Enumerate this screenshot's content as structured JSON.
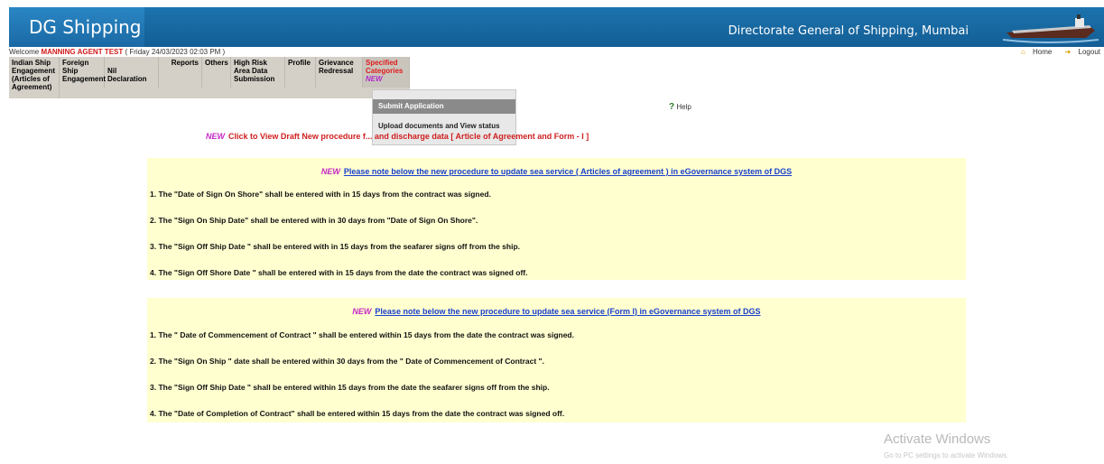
{
  "header": {
    "app_title": "DG Shipping",
    "org_title": "Directorate General of Shipping, Mumbai"
  },
  "welcome": {
    "prefix": "Welcome",
    "agent": "MANNING AGENT TEST",
    "datetime": "( Friday 24/03/2023 02:03 PM )",
    "home_label": "Home",
    "logout_label": "Logout"
  },
  "menu": {
    "items": [
      "Indian Ship Engagement (Articles of Agreement)",
      "Foreign Ship Engagement",
      "Nil Declaration",
      "Reports",
      "Others",
      "High Risk Area Data Submission",
      "Profile",
      "Grievance Redressal",
      "Specified Categories"
    ],
    "new_badge": "NEW"
  },
  "dropdown": {
    "items": [
      "Submit Application",
      "Upload documents and View status"
    ]
  },
  "help_label": "Help",
  "draft_notice": "Click to View Draft New procedure f... and discharge data [ Article of Agreement and Form - I ]",
  "panel1": {
    "heading": "Please note below the new procedure to update sea service ( Articles of agreement ) in eGovernance system of DGS",
    "rules": [
      "1. The \"Date of Sign On Shore\" shall be entered with in 15 days from the contract was signed.",
      "2. The \"Sign On Ship Date\" shall be entered with in 30 days from \"Date of Sign On Shore\".",
      "3. The \"Sign Off Ship Date \" shall be entered with in 15 days from the seafarer signs off from the ship.",
      "4. The \"Sign Off Shore Date \" shall be entered with in 15 days from the date the contract was signed off."
    ]
  },
  "panel2": {
    "heading": "Please note below the new procedure to update sea service (Form I) in eGovernance system of DGS",
    "rules": [
      "1. The \" Date of Commencement of Contract \" shall be entered within 15 days from the date the contract was signed.",
      "2. The \"Sign On Ship \" date shall be entered within 30 days from the \" Date of Commencement of Contract \".",
      "3. The \"Sign Off Ship Date \" shall be entered within 15 days from the date the seafarer signs off from the ship.",
      "4. The \"Date of Completion of Contract\" shall be entered within 15 days from the date the contract was signed off."
    ]
  },
  "watermark": {
    "title": "Activate Windows",
    "subtitle": "Go to PC settings to activate Windows."
  },
  "colors": {
    "header_blue": "#1c73ae",
    "agent_red": "#d11a1a",
    "new_magenta": "#c428c4",
    "panel_yellow": "#ffffd0",
    "link_blue": "#1a3fcc"
  }
}
